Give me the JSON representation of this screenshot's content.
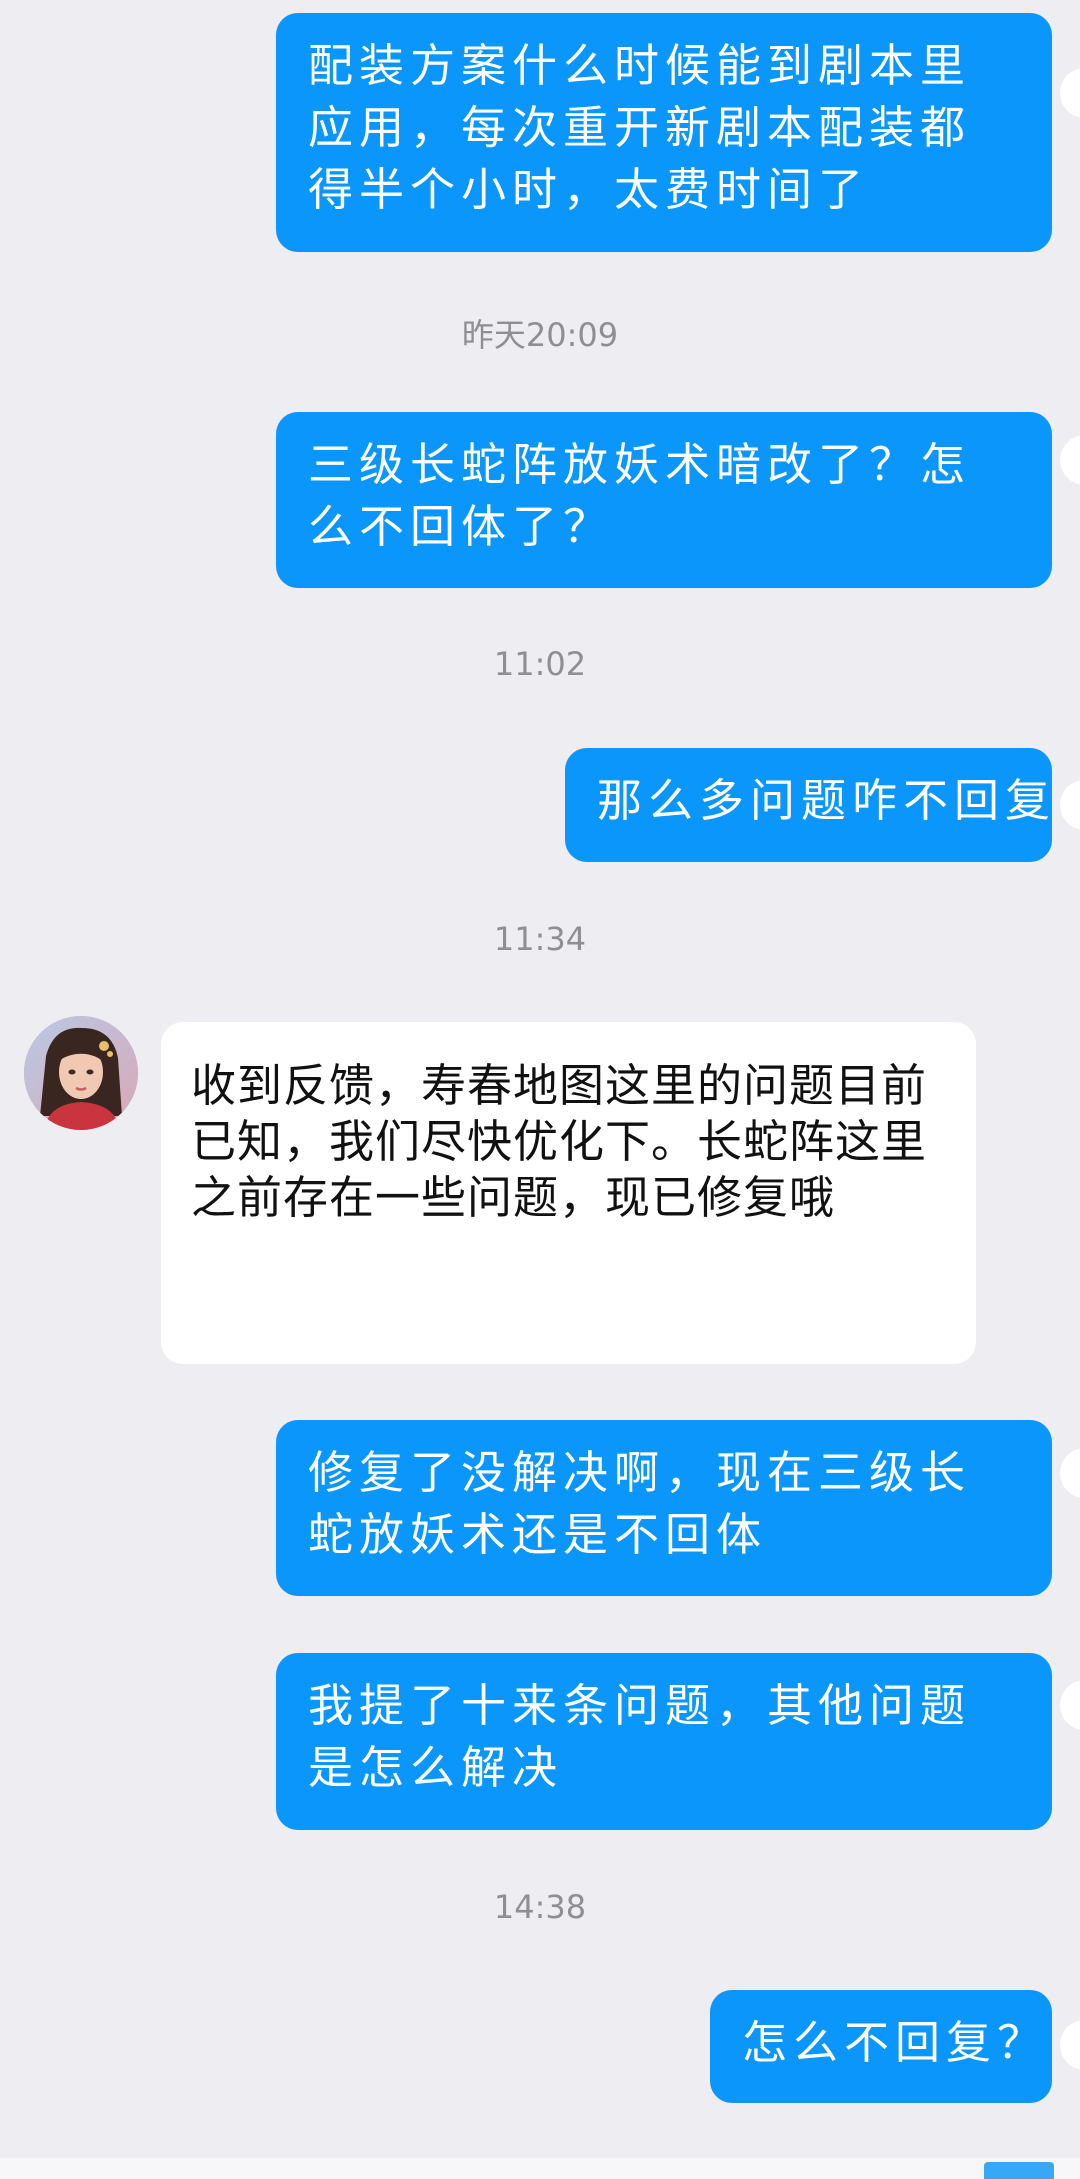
{
  "messages": [
    {
      "side": "out",
      "text": "配装方案什么时候能到剧本里应用，每次重开新剧本配装都得半个小时，太费时间了"
    },
    {
      "side": "out",
      "text": "三级长蛇阵放妖术暗改了？怎么不回体了？"
    },
    {
      "side": "out",
      "text": "那么多问题咋不回复"
    },
    {
      "side": "in",
      "text": "收到反馈，寿春地图这里的问题目前已知，我们尽快优化下。长蛇阵这里之前存在一些问题，现已修复哦"
    },
    {
      "side": "out",
      "text": "修复了没解决啊，现在三级长蛇放妖术还是不回体"
    },
    {
      "side": "out",
      "text": "我提了十来条问题，其他问题是怎么解决"
    },
    {
      "side": "out",
      "text": "怎么不回复？"
    }
  ],
  "timestamps": [
    "昨天20:09",
    "11:02",
    "11:34",
    "14:38"
  ],
  "colors": {
    "outgoing_bubble": "#0a96fa",
    "incoming_bubble": "#ffffff",
    "background": "#ededf2"
  },
  "icons": {
    "agent_avatar": "support-agent-avatar"
  }
}
